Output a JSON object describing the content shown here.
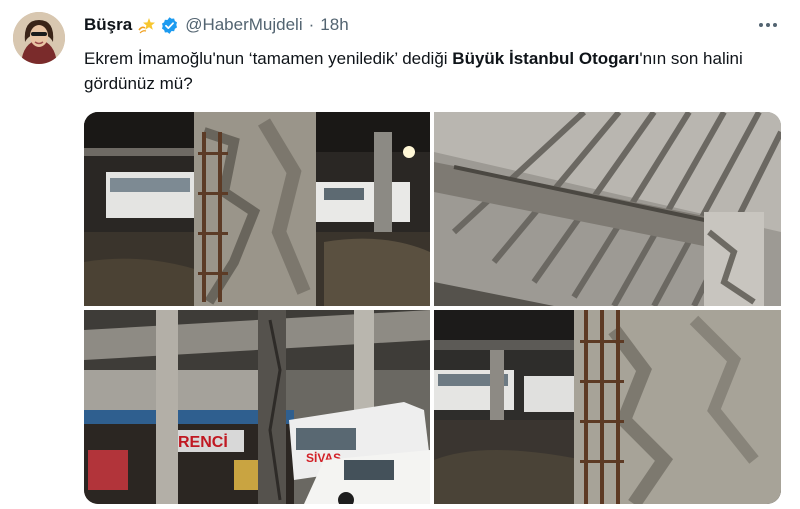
{
  "author": {
    "display_name": "Büşra",
    "emoji_icon": "dizzy-star-emoji",
    "verified_icon": "verified-badge-icon",
    "handle": "@HaberMujdeli",
    "separator": "·",
    "time": "18h"
  },
  "tweet": {
    "text_part1": "Ekrem İmamoğlu'nun ‘tamamen yeniledik’ dediği ",
    "text_bold1": "Büyük İstanbul Otogarı",
    "text_part2": "'nın son halini gördünüz mü?"
  },
  "media": {
    "photos": [
      {
        "id": "photo-1",
        "description_icon": "crumbling-column-photo"
      },
      {
        "id": "photo-2",
        "description_icon": "damaged-ceiling-photo"
      },
      {
        "id": "photo-3",
        "description_icon": "bus-station-street-photo",
        "signs": [
          "RENCİ",
          "SİVAS"
        ]
      },
      {
        "id": "photo-4",
        "description_icon": "damaged-pillar-photo"
      }
    ]
  },
  "colors": {
    "verified": "#1d9bf0",
    "text_primary": "#0f1419",
    "text_secondary": "#536471"
  }
}
